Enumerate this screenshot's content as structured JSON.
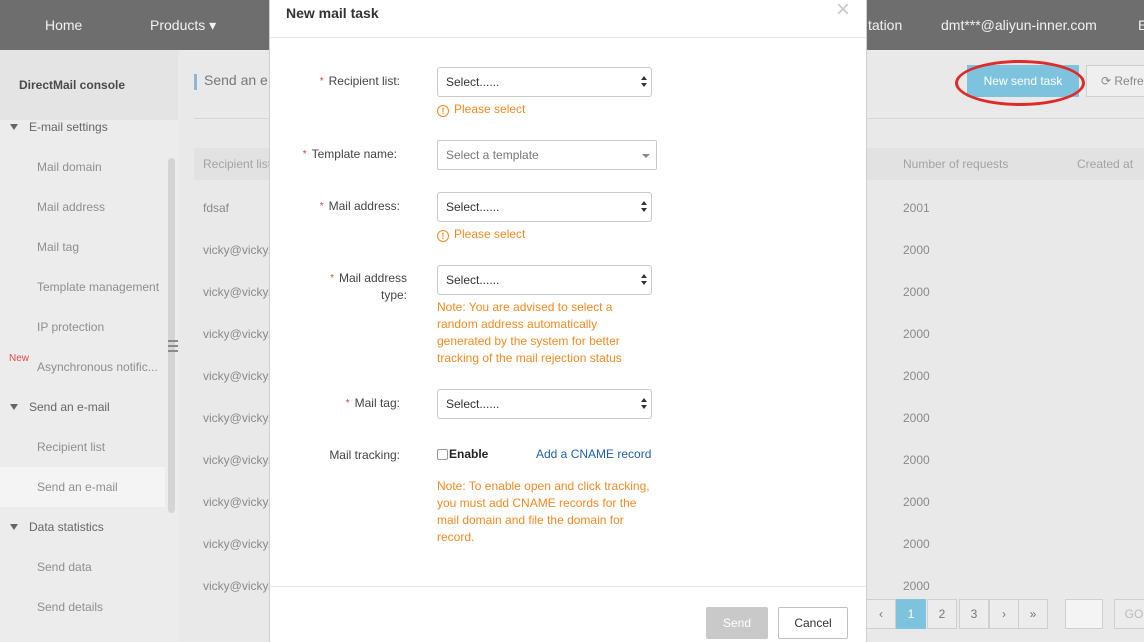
{
  "topnav": {
    "home": "Home",
    "products": "Products ▾",
    "tation": "tation",
    "account": "dmt***@aliyun-inner.com",
    "partial": "E"
  },
  "sidebar": {
    "title": "DirectMail console",
    "new_badge": "New",
    "items": [
      {
        "label": "E-mail settings",
        "type": "group"
      },
      {
        "label": "Mail domain",
        "type": "sub"
      },
      {
        "label": "Mail address",
        "type": "sub"
      },
      {
        "label": "Mail tag",
        "type": "sub"
      },
      {
        "label": "Template management",
        "type": "sub"
      },
      {
        "label": "IP protection",
        "type": "sub"
      },
      {
        "label": "Asynchronous notific...",
        "type": "sub"
      },
      {
        "label": "Send an e-mail",
        "type": "group"
      },
      {
        "label": "Recipient list",
        "type": "sub"
      },
      {
        "label": "Send an e-mail",
        "type": "sub",
        "active": true
      },
      {
        "label": "Data statistics",
        "type": "group"
      },
      {
        "label": "Send data",
        "type": "sub"
      },
      {
        "label": "Send details",
        "type": "sub"
      }
    ]
  },
  "main": {
    "page_title": "Send an e",
    "new_task_button": "New send task",
    "refresh_button": "Refre",
    "columns": {
      "recipient": "Recipient list",
      "requests": "Number of requests",
      "created": "Created at"
    },
    "rows": [
      {
        "recipient": "fdsaf",
        "requests": "2001"
      },
      {
        "recipient": "vicky@vicky.",
        "requests": "2000"
      },
      {
        "recipient": "vicky@vicky.",
        "requests": "2000"
      },
      {
        "recipient": "vicky@vicky.",
        "requests": "2000"
      },
      {
        "recipient": "vicky@vicky.",
        "requests": "2000"
      },
      {
        "recipient": "vicky@vicky.",
        "requests": "2000"
      },
      {
        "recipient": "vicky@vicky.",
        "requests": "2000"
      },
      {
        "recipient": "vicky@vicky.",
        "requests": "2000"
      },
      {
        "recipient": "vicky@vicky.",
        "requests": "2000"
      },
      {
        "recipient": "vicky@vicky.",
        "requests": "2000"
      }
    ],
    "pagination": {
      "prev": "‹",
      "pages": [
        "1",
        "2",
        "3"
      ],
      "next": "›",
      "last": "»",
      "go": "GO"
    }
  },
  "modal": {
    "title": "New mail task",
    "close": "×",
    "fields": {
      "recipient_list": {
        "label": "Recipient list:",
        "value": "Select......",
        "warning": "Please select"
      },
      "template_name": {
        "label": "Template name:",
        "value": "Select a template"
      },
      "mail_address": {
        "label": "Mail address:",
        "value": "Select......",
        "warning": "Please select"
      },
      "mail_address_type": {
        "label_line1": "Mail address",
        "label_line2": "type:",
        "value": "Select......",
        "note": "Note: You are advised to select a random address automatically generated by the system for better tracking of the mail rejection status"
      },
      "mail_tag": {
        "label": "Mail tag:",
        "value": "Select......"
      },
      "mail_tracking": {
        "label": "Mail tracking:",
        "checkbox_label": "Enable",
        "link": "Add a CNAME record",
        "note": "Note: To enable open and click tracking, you must add CNAME records for the mail domain and file the domain for record."
      }
    },
    "send_button": "Send",
    "cancel_button": "Cancel"
  },
  "colors": {
    "nav": "#6e6e6e",
    "accent": "#7ec3de",
    "warning": "#f08a24",
    "required": "#e23a3a",
    "highlight": "#e02a2a",
    "link": "#1f5fa8"
  }
}
